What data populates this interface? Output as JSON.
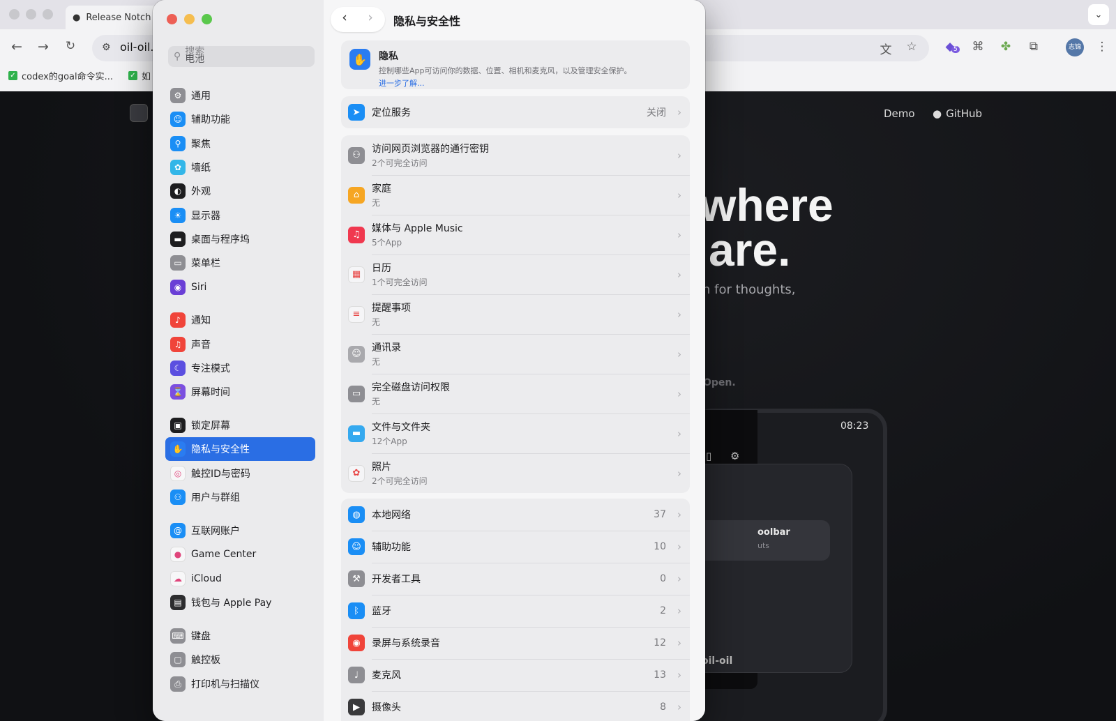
{
  "browser": {
    "tab_title": "Release Notch",
    "url_text": "oil-oil.",
    "bookmarks": [
      "codex的goal命令实...",
      "如"
    ],
    "profile_initials": "志锦",
    "extension_badge": "5"
  },
  "website": {
    "nav": [
      "Demo",
      "GitHub"
    ],
    "hero_line1": "where",
    "hero_line2": "are.",
    "hero_sub": "h for thoughts,",
    "fragment_open": "Open.",
    "device_time": "08:23",
    "card_title": "oolbar",
    "card_sub": "uts",
    "device_footer": "oil-oil"
  },
  "sidebar": {
    "search_placeholder": "搜索",
    "search_value": "电池",
    "items": [
      {
        "label": "通用",
        "icon": "gear-icon",
        "color": "#8e8e93",
        "glyph": "⚙"
      },
      {
        "label": "辅助功能",
        "icon": "accessibility-icon",
        "color": "#1a8ef5",
        "glyph": "☺"
      },
      {
        "label": "聚焦",
        "icon": "spotlight-icon",
        "color": "#1a8ef5",
        "glyph": "⚲"
      },
      {
        "label": "墙纸",
        "icon": "wallpaper-icon",
        "color": "#33b6e8",
        "glyph": "✿"
      },
      {
        "label": "外观",
        "icon": "appearance-icon",
        "color": "#1d1d1f",
        "glyph": "◐"
      },
      {
        "label": "显示器",
        "icon": "display-icon",
        "color": "#1a8ef5",
        "glyph": "☀"
      },
      {
        "label": "桌面与程序坞",
        "icon": "dock-icon",
        "color": "#1d1d1f",
        "glyph": "▬"
      },
      {
        "label": "菜单栏",
        "icon": "menubar-icon",
        "color": "#8e8e93",
        "glyph": "▭"
      },
      {
        "label": "Siri",
        "icon": "siri-icon",
        "color": "#6a3fd6",
        "glyph": "◉"
      },
      {
        "label": "通知",
        "icon": "bell-icon",
        "color": "#f0443a",
        "glyph": "♪"
      },
      {
        "label": "声音",
        "icon": "speaker-icon",
        "color": "#f0443a",
        "glyph": "♫"
      },
      {
        "label": "专注模式",
        "icon": "moon-icon",
        "color": "#5b4fe0",
        "glyph": "☾"
      },
      {
        "label": "屏幕时间",
        "icon": "hourglass-icon",
        "color": "#7b4fe0",
        "glyph": "⌛"
      },
      {
        "label": "锁定屏幕",
        "icon": "lock-icon",
        "color": "#1d1d1f",
        "glyph": "▣"
      },
      {
        "label": "隐私与安全性",
        "icon": "hand-icon",
        "color": "#2a7cf1",
        "glyph": "✋"
      },
      {
        "label": "触控ID与密码",
        "icon": "fingerprint-icon",
        "color": "#f7f7f8",
        "glyph": "◎"
      },
      {
        "label": "用户与群组",
        "icon": "users-icon",
        "color": "#1a8ef5",
        "glyph": "⚇"
      },
      {
        "label": "互联网账户",
        "icon": "at-icon",
        "color": "#1a8ef5",
        "glyph": "@"
      },
      {
        "label": "Game Center",
        "icon": "game-center-icon",
        "color": "#f7f7f8",
        "glyph": "●"
      },
      {
        "label": "iCloud",
        "icon": "cloud-icon",
        "color": "#f7f7f8",
        "glyph": "☁"
      },
      {
        "label": "钱包与 Apple Pay",
        "icon": "wallet-icon",
        "color": "#2d2d2f",
        "glyph": "▤"
      },
      {
        "label": "键盘",
        "icon": "keyboard-icon",
        "color": "#8e8e93",
        "glyph": "⌨"
      },
      {
        "label": "触控板",
        "icon": "trackpad-icon",
        "color": "#8e8e93",
        "glyph": "▢"
      },
      {
        "label": "打印机与扫描仪",
        "icon": "printer-icon",
        "color": "#8e8e93",
        "glyph": "⎙"
      }
    ],
    "active_index": 14
  },
  "main": {
    "title": "隐私与安全性",
    "privacy_header": {
      "title": "隐私",
      "desc": "控制哪些App可访问你的数据、位置、相机和麦克风，以及管理安全保护。",
      "link": "进一步了解..."
    },
    "location": {
      "label": "定位服务",
      "value": "关闭"
    },
    "access_rows": [
      {
        "label": "访问网页浏览器的通行密钥",
        "sub": "2个可完全访问",
        "icon": "passkey-icon",
        "color": "#8e8e93",
        "glyph": "⚇"
      },
      {
        "label": "家庭",
        "sub": "无",
        "icon": "home-icon",
        "color": "#f6a623",
        "glyph": "⌂"
      },
      {
        "label": "媒体与 Apple Music",
        "sub": "5个App",
        "icon": "music-icon",
        "color": "#f0384f",
        "glyph": "♫"
      },
      {
        "label": "日历",
        "sub": "1个可完全访问",
        "icon": "calendar-icon",
        "color": "#f5f5f7",
        "glyph": "▦"
      },
      {
        "label": "提醒事项",
        "sub": "无",
        "icon": "reminders-icon",
        "color": "#f5f5f7",
        "glyph": "≡"
      },
      {
        "label": "通讯录",
        "sub": "无",
        "icon": "contacts-icon",
        "color": "#a9a9ad",
        "glyph": "☺"
      },
      {
        "label": "完全磁盘访问权限",
        "sub": "无",
        "icon": "disk-icon",
        "color": "#8e8e93",
        "glyph": "▭"
      },
      {
        "label": "文件与文件夹",
        "sub": "12个App",
        "icon": "folder-icon",
        "color": "#35a9ef",
        "glyph": "▬"
      },
      {
        "label": "照片",
        "sub": "2个可完全访问",
        "icon": "photos-icon",
        "color": "#f5f5f7",
        "glyph": "✿"
      }
    ],
    "count_rows": [
      {
        "label": "本地网络",
        "value": "37",
        "icon": "globe-icon",
        "color": "#1a8ef5",
        "glyph": "◍"
      },
      {
        "label": "辅助功能",
        "value": "10",
        "icon": "accessibility-icon",
        "color": "#1a8ef5",
        "glyph": "☺"
      },
      {
        "label": "开发者工具",
        "value": "0",
        "icon": "hammer-icon",
        "color": "#8e8e93",
        "glyph": "⚒"
      },
      {
        "label": "蓝牙",
        "value": "2",
        "icon": "bluetooth-icon",
        "color": "#1a8ef5",
        "glyph": "ᛒ"
      },
      {
        "label": "录屏与系统录音",
        "value": "12",
        "icon": "record-icon",
        "color": "#f0443a",
        "glyph": "◉"
      },
      {
        "label": "麦克风",
        "value": "13",
        "icon": "microphone-icon",
        "color": "#8e8e93",
        "glyph": "♩"
      },
      {
        "label": "摄像头",
        "value": "8",
        "icon": "camera-icon",
        "color": "#3a3a3c",
        "glyph": "▶"
      }
    ]
  }
}
